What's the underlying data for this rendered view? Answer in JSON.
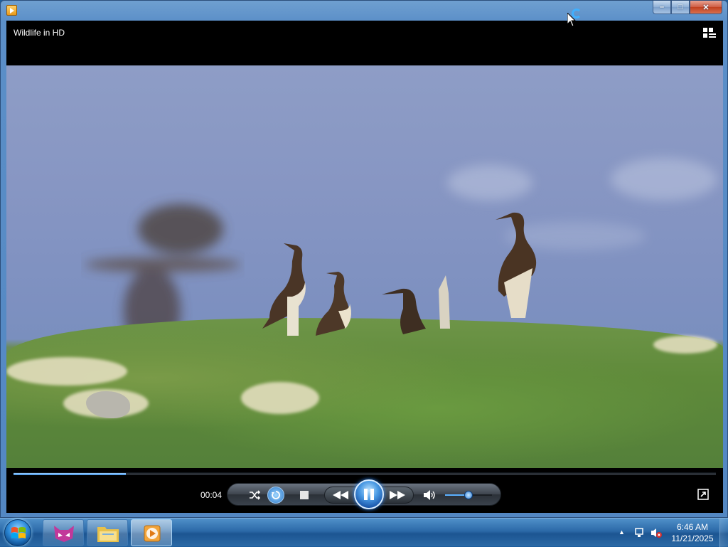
{
  "window": {
    "app_icon": "media-player-icon",
    "controls": {
      "minimize": "–",
      "maximize": "□",
      "close": "✕"
    }
  },
  "player": {
    "now_playing_title": "Wildlife in HD",
    "switch_to_library_icon": "switch-to-library-icon",
    "elapsed_time": "00:04",
    "seek_progress_fraction": 0.16,
    "volume_fraction": 0.5,
    "controls": {
      "shuffle_icon": "shuffle-icon",
      "repeat_icon": "repeat-icon",
      "stop_icon": "stop-icon",
      "previous_icon": "rewind-icon",
      "play_pause_icon": "pause-icon",
      "next_icon": "fast-forward-icon",
      "mute_icon": "speaker-icon",
      "fullscreen_icon": "fullscreen-icon"
    }
  },
  "taskbar": {
    "start_icon": "windows-logo-icon",
    "pinned": [
      {
        "name": "fox-app-icon",
        "active": false
      },
      {
        "name": "folder-icon",
        "active": false
      },
      {
        "name": "media-player-icon",
        "active": true
      }
    ],
    "tray": {
      "overflow_icon": "show-hidden-icons-icon",
      "network_icon": "network-icon",
      "volume_icon": "volume-muted-icon"
    },
    "clock": {
      "time": "6:46 AM",
      "date": "11/21/2025"
    }
  },
  "colors": {
    "accent": "#3f8fe0",
    "taskbar": "#2c6aa8"
  }
}
